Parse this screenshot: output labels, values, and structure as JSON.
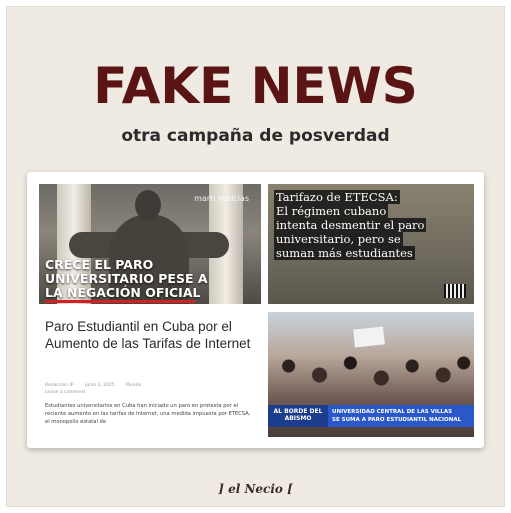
{
  "poster": {
    "headline": "FAKE NEWS",
    "subheadline": "otra campaña de posverdad",
    "footer_brand": "] el Necio [",
    "colors": {
      "headline": "#5a1414",
      "background": "#efeae2"
    }
  },
  "collage": {
    "top_left": {
      "logo": "marti noticias",
      "overlay_lines": [
        "CRECE EL PARO",
        "UNIVERSITARIO PESE A",
        "LA NEGACIÓN OFICIAL"
      ]
    },
    "top_right": {
      "lines": [
        "Tarifazo de ETECSA:",
        "El régimen cubano",
        "intenta desmentir el paro",
        "universitario, pero se",
        "suman más estudiantes"
      ]
    },
    "article": {
      "title": "Paro Estudiantil en Cuba por el Aumento de las Tarifas de Internet",
      "meta": [
        "Redacción IP",
        "junio 3, 2025",
        "Mundo",
        "Leave a comment"
      ],
      "body": "Estudiantes universitarios en Cuba han iniciado un paro en protesta por el reciente aumento en las tarifas de Internet, una medida impuesta por ETECSA, el monopolio estatal de"
    },
    "bottom_right": {
      "badge": "AL BORDE DEL ABISMO",
      "caption_line1": "UNIVERSIDAD CENTRAL DE LAS VILLAS",
      "caption_line2": "SE SUMA A PARO ESTUDIANTIL NACIONAL"
    }
  }
}
